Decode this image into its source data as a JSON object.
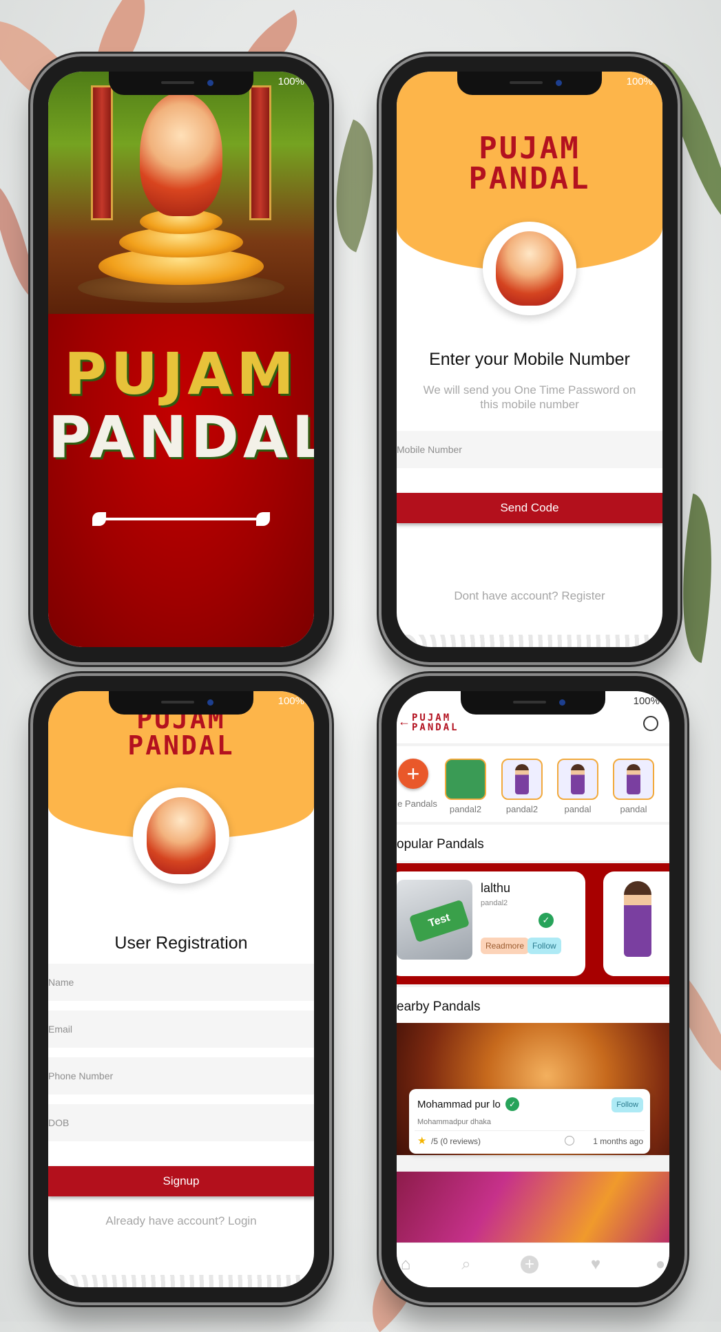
{
  "splash": {
    "status": "100%",
    "logo_line1": "PUJAM",
    "logo_line2": "PANDAL"
  },
  "login": {
    "status": "100%",
    "logo_line1": "PUJAM",
    "logo_line2": "PANDAL",
    "title": "Enter your Mobile Number",
    "subtitle": "We will send you One Time Password on this mobile number",
    "mobile_placeholder": "Mobile Number",
    "send_button": "Send Code",
    "register_link": "Dont have account? Register"
  },
  "register": {
    "status": "100%",
    "logo_line1": "PUJAM",
    "logo_line2": "PANDAL",
    "title": "User Registration",
    "name_placeholder": "Name",
    "email_placeholder": "Email",
    "phone_placeholder": "Phone Number",
    "dob_placeholder": "DOB",
    "signup_button": "Signup",
    "login_link": "Already have account? Login"
  },
  "home": {
    "status": "100%",
    "logo_line1": "PUJAM",
    "logo_line2": "PANDAL",
    "stories": [
      {
        "label": "e Pandals"
      },
      {
        "label": "pandal2"
      },
      {
        "label": "pandal2"
      },
      {
        "label": "pandal"
      },
      {
        "label": "pandal"
      }
    ],
    "popular_title": "opular Pandals",
    "popular_card": {
      "image_text": "Test",
      "name": "lalthu",
      "subtitle": "pandal2",
      "readmore": "Readmore",
      "follow": "Follow"
    },
    "nearby_title": "earby Pandals",
    "nearby_card": {
      "name": "Mohammad pur lo",
      "address": "Mohammadpur dhaka",
      "rating": "/5 (0 reviews)",
      "time": "1 months ago",
      "follow": "Follow"
    }
  },
  "colors": {
    "brand_red": "#b3101c",
    "brand_orange": "#fdb54a"
  }
}
